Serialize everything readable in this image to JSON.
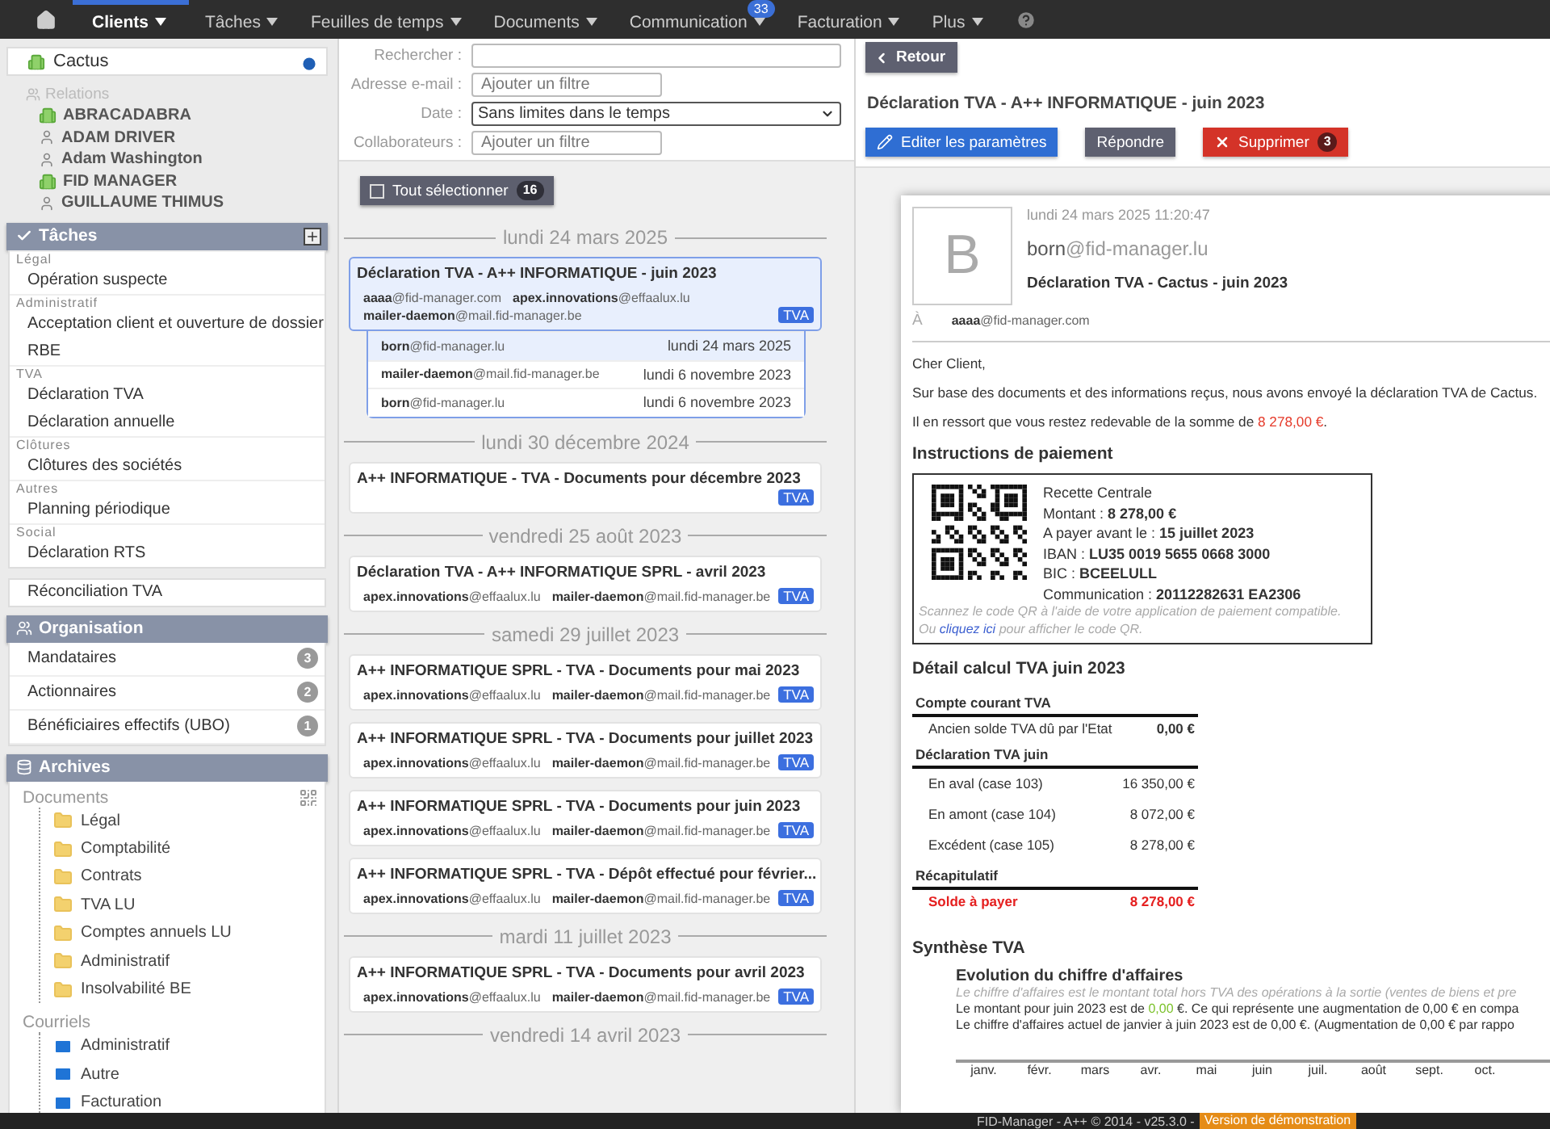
{
  "nav": {
    "items": [
      {
        "label": "Clients",
        "selected": true
      },
      {
        "label": "Tâches",
        "selected": false
      },
      {
        "label": "Feuilles de temps",
        "selected": false
      },
      {
        "label": "Documents",
        "selected": false
      },
      {
        "label": "Communication",
        "selected": false,
        "badge": "33"
      },
      {
        "label": "Facturation",
        "selected": false
      },
      {
        "label": "Plus",
        "selected": false
      }
    ]
  },
  "sidebar": {
    "client": {
      "name": "Cactus"
    },
    "relations": {
      "label": "Relations",
      "items": [
        {
          "name": "ABRACADABRA",
          "kind": "company"
        },
        {
          "name": "ADAM DRIVER",
          "kind": "person"
        },
        {
          "name": "Adam Washington",
          "kind": "person"
        },
        {
          "name": "FID MANAGER",
          "kind": "company"
        },
        {
          "name": "GUILLAUME THIMUS",
          "kind": "person"
        }
      ]
    },
    "tasks": {
      "title": "Tâches",
      "groups": [
        {
          "category": "Légal",
          "items": [
            "Opération suspecte"
          ]
        },
        {
          "category": "Administratif",
          "items": [
            "Acceptation client et ouverture de dossier",
            "RBE"
          ]
        },
        {
          "category": "TVA",
          "items": [
            "Déclaration TVA",
            "Déclaration annuelle"
          ]
        },
        {
          "category": "Clôtures",
          "items": [
            "Clôtures des sociétés"
          ]
        },
        {
          "category": "Autres",
          "items": [
            "Planning périodique"
          ]
        },
        {
          "category": "Social",
          "items": [
            "Déclaration RTS"
          ]
        }
      ]
    },
    "reconciliation": "Réconciliation TVA",
    "organisation": {
      "title": "Organisation",
      "items": [
        {
          "label": "Mandataires",
          "count": "3"
        },
        {
          "label": "Actionnaires",
          "count": "2"
        },
        {
          "label": "Bénéficiaires effectifs (UBO)",
          "count": "1"
        }
      ]
    },
    "archives": {
      "title": "Archives",
      "sections": [
        {
          "label": "Documents",
          "kind": "folder",
          "items": [
            "Légal",
            "Comptabilité",
            "Contrats",
            "TVA LU",
            "Comptes annuels LU",
            "Administratif",
            "Insolvabilité BE"
          ]
        },
        {
          "label": "Courriels",
          "kind": "mail",
          "items": [
            "Administratif",
            "Autre",
            "Facturation"
          ]
        }
      ]
    }
  },
  "filters": [
    {
      "label": "Rechercher :",
      "kind": "text"
    },
    {
      "label": "Adresse e-mail :",
      "kind": "text",
      "placeholder": "Ajouter un filtre"
    },
    {
      "label": "Date :",
      "kind": "select",
      "value": "Sans limites dans le temps"
    },
    {
      "label": "Collaborateurs :",
      "kind": "text",
      "placeholder": "Ajouter un filtre"
    }
  ],
  "select_all": {
    "label": "Tout sélectionner",
    "count": "16",
    "checked": false
  },
  "threads": [
    {
      "date": "lundi 24 mars 2025",
      "items": [
        {
          "subject": "Déclaration TVA - A++ INFORMATIQUE - juin 2023",
          "tag": "TVA",
          "selected": true,
          "addresses": [
            {
              "user": "aaaa",
              "domain": "@fid-manager.com"
            },
            {
              "user": "apex.innovations",
              "domain": "@effaalux.lu"
            },
            {
              "user": "mailer-daemon",
              "domain": "@mail.fid-manager.be"
            }
          ],
          "messages": [
            {
              "user": "born",
              "domain": "@fid-manager.lu",
              "date": "lundi 24 mars 2025",
              "selected": true
            },
            {
              "user": "mailer-daemon",
              "domain": "@mail.fid-manager.be",
              "date": "lundi 6 novembre 2023",
              "selected": false
            },
            {
              "user": "born",
              "domain": "@fid-manager.lu",
              "date": "lundi 6 novembre 2023",
              "selected": false
            }
          ]
        }
      ]
    },
    {
      "date": "lundi 30 décembre 2024",
      "items": [
        {
          "subject": "A++ INFORMATIQUE - TVA - Documents pour décembre 2023",
          "tag": "TVA",
          "selected": false
        }
      ]
    },
    {
      "date": "vendredi 25 août 2023",
      "items": [
        {
          "subject": "Déclaration TVA - A++ INFORMATIQUE SPRL - avril 2023",
          "tag": "TVA",
          "selected": false,
          "addresses": [
            {
              "user": "apex.innovations",
              "domain": "@effaalux.lu"
            },
            {
              "user": "mailer-daemon",
              "domain": "@mail.fid-manager.be"
            }
          ]
        }
      ]
    },
    {
      "date": "samedi 29 juillet 2023",
      "items": [
        {
          "subject": "A++ INFORMATIQUE SPRL - TVA - Documents pour mai 2023",
          "tag": "TVA",
          "selected": false,
          "addresses": [
            {
              "user": "apex.innovations",
              "domain": "@effaalux.lu"
            },
            {
              "user": "mailer-daemon",
              "domain": "@mail.fid-manager.be"
            }
          ]
        },
        {
          "subject": "A++ INFORMATIQUE SPRL - TVA - Documents pour juillet 2023",
          "tag": "TVA",
          "selected": false,
          "addresses": [
            {
              "user": "apex.innovations",
              "domain": "@effaalux.lu"
            },
            {
              "user": "mailer-daemon",
              "domain": "@mail.fid-manager.be"
            }
          ]
        },
        {
          "subject": "A++ INFORMATIQUE SPRL - TVA - Documents pour juin 2023",
          "tag": "TVA",
          "selected": false,
          "addresses": [
            {
              "user": "apex.innovations",
              "domain": "@effaalux.lu"
            },
            {
              "user": "mailer-daemon",
              "domain": "@mail.fid-manager.be"
            }
          ]
        },
        {
          "subject": "A++ INFORMATIQUE SPRL - TVA - Dépôt effectué pour février...",
          "tag": "TVA",
          "selected": false,
          "addresses": [
            {
              "user": "apex.innovations",
              "domain": "@effaalux.lu"
            },
            {
              "user": "mailer-daemon",
              "domain": "@mail.fid-manager.be"
            }
          ]
        }
      ]
    },
    {
      "date": "mardi 11 juillet 2023",
      "items": [
        {
          "subject": "A++ INFORMATIQUE SPRL - TVA - Documents pour avril 2023",
          "tag": "TVA",
          "selected": false,
          "addresses": [
            {
              "user": "apex.innovations",
              "domain": "@effaalux.lu"
            },
            {
              "user": "mailer-daemon",
              "domain": "@mail.fid-manager.be"
            }
          ]
        }
      ]
    },
    {
      "date": "vendredi 14 avril 2023"
    }
  ],
  "detail": {
    "back": "Retour",
    "title": "Déclaration TVA - A++ INFORMATIQUE - juin 2023",
    "actions": [
      {
        "label": "Editer les paramètres",
        "kind": "edit"
      },
      {
        "label": "Répondre",
        "kind": "reply"
      },
      {
        "label": "Supprimer",
        "kind": "delete",
        "count": "3"
      }
    ],
    "email": {
      "avatar": "B",
      "date": "lundi 24 mars 2025 11:20:47",
      "sender": {
        "user": "born",
        "domain": "@fid-manager.lu"
      },
      "subject": "Déclaration TVA - Cactus - juin 2023",
      "to_label": "À",
      "to": {
        "user": "aaaa",
        "domain": "@fid-manager.com"
      },
      "greeting": "Cher Client,",
      "paragraph": "Sur base des documents et des informations reçus, nous avons envoyé la déclaration TVA de Cactus.",
      "due": {
        "text": "Il en ressort que vous restez redevable de la somme de ",
        "amount": "8 278,00 €",
        "after": "."
      },
      "payment": {
        "title": "Instructions de paiement",
        "lines": [
          "Recette Centrale",
          "Montant : **8 278,00 €**",
          "A payer avant le : **15 juillet 2023**",
          "IBAN : **LU35 0019 5655 0668 3000**",
          "BIC : **BCEELULL**",
          "Communication : **20112282631 EA2306**"
        ],
        "note": "Scannez le code QR à l'aide de votre application de paiement compatible.",
        "link_before": "Ou ",
        "link": "cliquez ici",
        "link_after": " pour afficher le code QR."
      },
      "calc": {
        "title": "Détail calcul TVA juin 2023",
        "sections": [
          {
            "title": "Compte courant TVA",
            "rows": [
              {
                "label": "Ancien solde TVA dû par l'Etat",
                "value": "0,00 €",
                "kind": "bold"
              }
            ]
          },
          {
            "title": "Déclaration TVA juin",
            "rows": [
              {
                "label": "En aval (case 103)",
                "value": "16 350,00 €",
                "kind": "plain"
              },
              {
                "label": "En amont (case 104)",
                "value": "8 072,00 €",
                "kind": "plain"
              },
              {
                "label": "Excédent (case 105)",
                "value": "8 278,00 €",
                "kind": "plain"
              }
            ]
          },
          {
            "title": "Récapitulatif",
            "rows": [
              {
                "label": "Solde à payer",
                "value": "8 278,00 €",
                "kind": "total"
              }
            ]
          }
        ]
      },
      "synthese": {
        "title": "Synthèse TVA",
        "subtitle": "Evolution du chiffre d'affaires",
        "note": "Le chiffre d'affaires est le montant total hors TVA des opérations à la sortie (ventes de biens et pre",
        "line1": {
          "before": "Le montant pour juin 2023 est de ",
          "value": "0,00",
          "after": " €. Ce qui représente une augmentation de 0,00 € en compa"
        },
        "line2": "Le chiffre d'affaires actuel de janvier à juin 2023 est de 0,00 €. (Augmentation de 0,00 € par rappo",
        "months": [
          "janv.",
          "févr.",
          "mars",
          "avr.",
          "mai",
          "juin",
          "juil.",
          "août",
          "sept.",
          "oct."
        ]
      }
    }
  },
  "footer": {
    "text": "FID-Manager - A++ © 2014 - v25.3.0 -",
    "badge": "Version de démonstration"
  }
}
